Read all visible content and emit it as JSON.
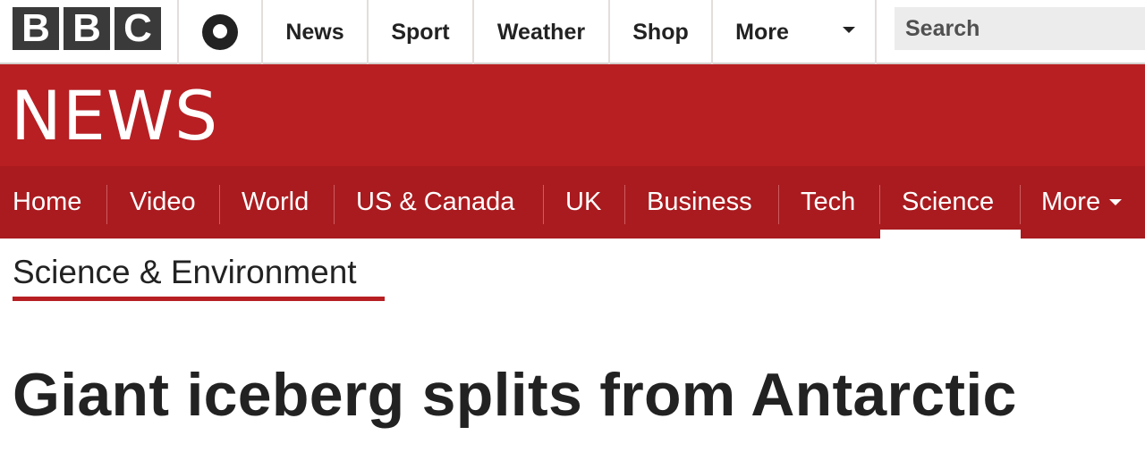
{
  "topbar": {
    "logo_letters": [
      "B",
      "B",
      "C"
    ],
    "account_icon": "user-account-icon",
    "links": [
      {
        "label": "News"
      },
      {
        "label": "Sport"
      },
      {
        "label": "Weather"
      },
      {
        "label": "Shop"
      },
      {
        "label": "More"
      }
    ],
    "search_placeholder": "Search"
  },
  "masthead": {
    "title": "NEWS",
    "color": "#b71f23"
  },
  "nav": {
    "items": [
      {
        "label": "Home"
      },
      {
        "label": "Video"
      },
      {
        "label": "World"
      },
      {
        "label": "US & Canada"
      },
      {
        "label": "UK"
      },
      {
        "label": "Business"
      },
      {
        "label": "Tech"
      },
      {
        "label": "Science",
        "active": true
      },
      {
        "label": "More"
      }
    ],
    "color": "#a91b1f"
  },
  "section": {
    "title": "Science & Environment"
  },
  "article": {
    "headline": "Giant iceberg splits from Antarctic"
  }
}
